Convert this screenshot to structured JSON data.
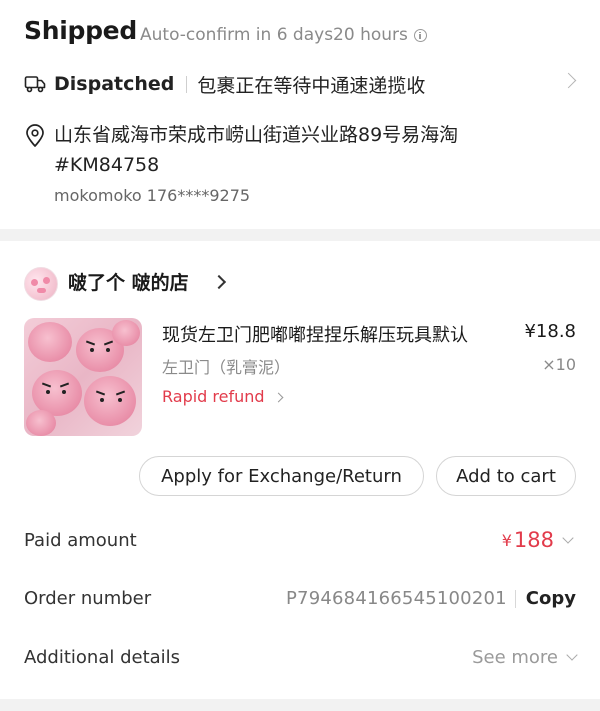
{
  "shipping": {
    "status_title": "Shipped",
    "auto_confirm": "Auto-confirm in 6 days20 hours",
    "dispatch_label": "Dispatched",
    "dispatch_text": "包裹正在等待中通速递揽收",
    "address": "山东省威海市荣成市崂山街道兴业路89号易海淘#KM84758",
    "contact": "mokomoko 176****9275"
  },
  "store": {
    "name": "啵了个 啵的店"
  },
  "product": {
    "title": "现货左卫门肥嘟嘟捏捏乐解压玩具默认",
    "price": "¥18.8",
    "variant": "左卫门（乳膏泥）",
    "quantity": "×10",
    "rapid_refund": "Rapid refund"
  },
  "actions": {
    "exchange_label": "Apply for Exchange/Return",
    "cart_label": "Add to cart"
  },
  "summary": {
    "paid_label": "Paid amount",
    "paid_currency": "¥",
    "paid_value": "188",
    "order_label": "Order number",
    "order_number": "P794684166545100201",
    "copy_label": "Copy",
    "details_label": "Additional details",
    "see_more_label": "See more"
  },
  "colors": {
    "accent_red": "#e23b4b",
    "muted_gray": "#8a8a8a",
    "page_background": "#f2f2f2"
  },
  "icons": [
    "info-icon",
    "truck-icon",
    "location-pin-icon",
    "chevron-right-icon",
    "chevron-down-icon"
  ]
}
